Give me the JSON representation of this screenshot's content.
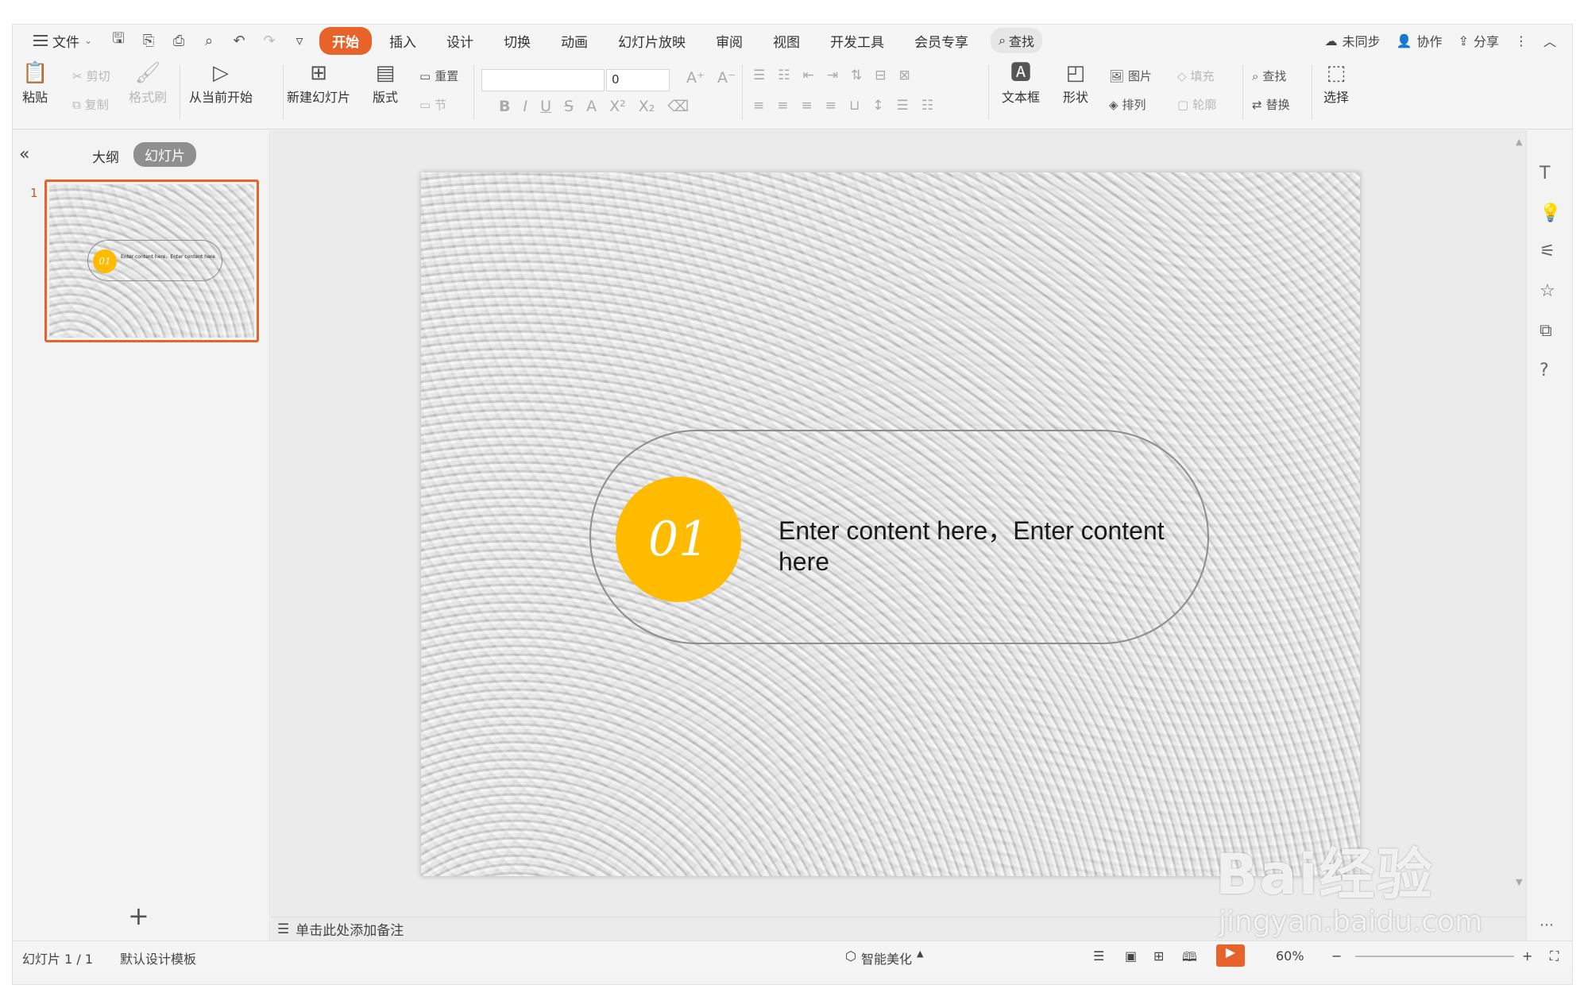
{
  "menubar": {
    "file_label": "文件",
    "tabs": [
      {
        "label": "开始",
        "active": true
      },
      {
        "label": "插入"
      },
      {
        "label": "设计"
      },
      {
        "label": "切换"
      },
      {
        "label": "动画"
      },
      {
        "label": "幻灯片放映"
      },
      {
        "label": "审阅"
      },
      {
        "label": "视图"
      },
      {
        "label": "开发工具"
      },
      {
        "label": "会员专享"
      }
    ],
    "search_label": "查找",
    "right": {
      "sync": "未同步",
      "collab": "协作",
      "share": "分享"
    }
  },
  "ribbon": {
    "paste": "粘贴",
    "cut": "剪切",
    "copy": "复制",
    "format_painter": "格式刷",
    "from_current": "从当前开始",
    "new_slide": "新建幻灯片",
    "layout": "版式",
    "reset": "重置",
    "section": "节",
    "font_size": "0",
    "textbox": "文本框",
    "shape": "形状",
    "picture": "图片",
    "arrange": "排列",
    "fill": "填充",
    "outline": "轮廓",
    "find": "查找",
    "replace": "替换",
    "select": "选择"
  },
  "leftpanel": {
    "tab_outline": "大纲",
    "tab_slides": "幻灯片",
    "thumb_number": "1",
    "add_icon": "+"
  },
  "slide": {
    "badge_number": "01",
    "content": "Enter content here，Enter content here",
    "badge_color": "#ffbb00",
    "thumb_content": "Enter content here，Enter content here"
  },
  "notes": {
    "placeholder": "单击此处添加备注"
  },
  "status": {
    "slide_counter": "幻灯片 1 / 1",
    "template": "默认设计模板",
    "beautify": "智能美化",
    "zoom": "60%"
  },
  "watermark": {
    "logo": "Bai经验",
    "url": "jingyan.baidu.com"
  },
  "colors": {
    "accent": "#e8632a",
    "badge": "#ffbb00"
  }
}
